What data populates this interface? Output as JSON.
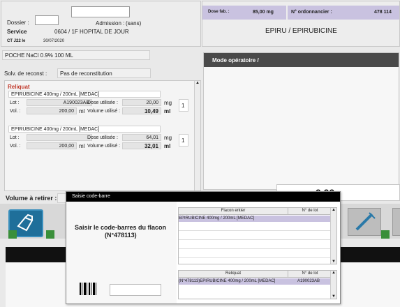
{
  "header": {
    "dossier_label": "Dossier :",
    "admission_label": "Admission :",
    "admission_value": "(sans)",
    "service_label": "Service",
    "service_value": "0604 / 1F HOPITAL DE JOUR",
    "ct_label": "CT J22 le",
    "ct_date": "30/07/2020",
    "dose_fab_label": "Dose fab. :",
    "dose_fab_value": "85,00 mg",
    "ordonnancier_label": "N° ordonnancier :",
    "ordonnancier_value": "478 114",
    "drug_title": "EPIRU / EPIRUBICINE"
  },
  "left": {
    "poche": "POCHE NaCl 0.9% 100 ML",
    "solv_label": "Solv. de reconst :",
    "solv_value": "Pas de reconstitution",
    "reliquat_title": "Reliquat",
    "items": [
      {
        "name": "EPIRUBICINE 400mg / 200mL [MEDAC]",
        "lot_label": "Lot :",
        "lot_value": "A190023AB",
        "dose_label": "Dose utilisée :",
        "dose_value": "20,00",
        "dose_unit": "mg",
        "vol_label": "Vol. :",
        "vol_value": "200,00",
        "vol_unit": "ml",
        "volused_label": "Volume utilisé :",
        "volused_value": "10,49",
        "volused_unit": "ml",
        "count": "1"
      },
      {
        "name": "EPIRUBICINE 400mg / 200mL [MEDAC]",
        "lot_label": "Lot :",
        "lot_value": "",
        "dose_label": "Dose utilisée :",
        "dose_value": "64,01",
        "dose_unit": "mg",
        "vol_label": "Vol. :",
        "vol_value": "200,00",
        "vol_unit": "ml",
        "volused_label": "Volume utilisé :",
        "volused_value": "32,01",
        "volused_unit": "ml",
        "count": "1"
      }
    ],
    "volume_retirer_label": "Volume à retirer :"
  },
  "right": {
    "mode_title": "Mode opératoire /",
    "big_value": "0,00"
  },
  "dialog": {
    "title": "Saisie code-barre",
    "prompt_line1": "Saisir le code-barres du flacon",
    "prompt_line2": "(N°478113)",
    "barcode_input": "",
    "table1": {
      "col1": "Flacon entier",
      "col2": "N° de lot",
      "rows": [
        {
          "name": "EPIRUBICINE 400mg / 200mL [MEDAC]",
          "lot": ""
        }
      ]
    },
    "table2": {
      "col1": "Reliquat",
      "col2": "N° de lot",
      "rows": [
        {
          "name": "(N°478113)EPIRUBICINE 400mg / 200mL [MEDAC]",
          "lot": "A190023AB"
        }
      ]
    }
  },
  "colors": {
    "header_purple": "#c9c2e0",
    "reliquat_red": "#c0392b",
    "status_green": "#3a8f3a",
    "icon_blue": "#1f6f9a",
    "dialog_title_bg": "#000000"
  },
  "icons": [
    "bottle-icon",
    "syringe-icon",
    "barcode-icon"
  ]
}
